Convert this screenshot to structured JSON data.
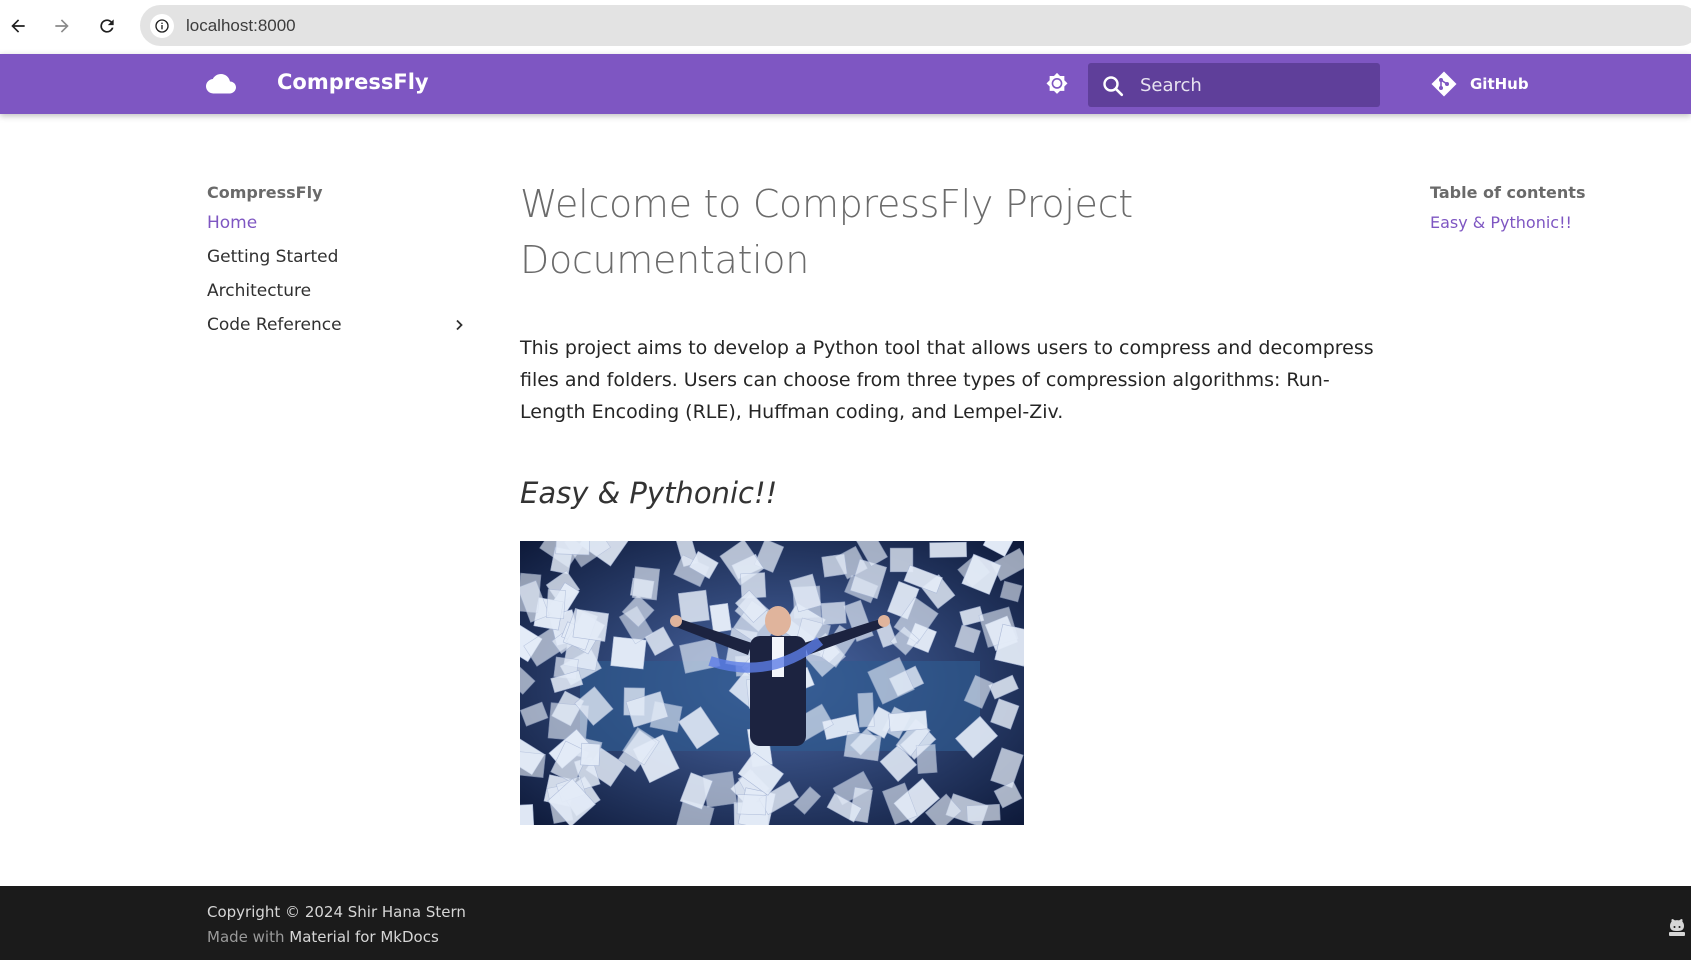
{
  "browser": {
    "url": "localhost:8000"
  },
  "header": {
    "site_title": "CompressFly",
    "search_placeholder": "Search",
    "repo_label": "GitHub"
  },
  "sidebar": {
    "title": "CompressFly",
    "items": [
      {
        "label": "Home",
        "active": true
      },
      {
        "label": "Getting Started",
        "active": false
      },
      {
        "label": "Architecture",
        "active": false
      },
      {
        "label": "Code Reference",
        "active": false
      }
    ]
  },
  "main": {
    "title": "Welcome to CompressFly Project Documentation",
    "intro": "This project aims to develop a Python tool that allows users to compress and decompress files and folders. Users can choose from three types of compression algorithms: Run-Length Encoding (RLE), Huffman coding, and Lempel-Ziv.",
    "section_heading": "Easy & Pythonic!!"
  },
  "toc": {
    "title": "Table of contents",
    "items": [
      "Easy & Pythonic!!"
    ]
  },
  "footer": {
    "copyright": "Copyright © 2024 Shir Hana Stern",
    "made_with_prefix": "Made with",
    "made_with_link": "Material for MkDocs"
  },
  "colors": {
    "primary": "#7e56c2",
    "footer": "#1b1b1b"
  }
}
